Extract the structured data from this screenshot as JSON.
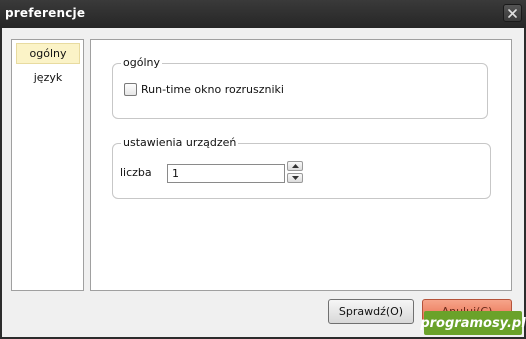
{
  "window": {
    "title": "preferencje",
    "close_glyph": "×"
  },
  "sidebar": {
    "items": [
      {
        "label": "ogólny",
        "selected": true
      },
      {
        "label": "język",
        "selected": false
      }
    ]
  },
  "general_group": {
    "legend": "ogólny",
    "checkbox_label": "Run-time okno rozruszniki",
    "checkbox_checked": false
  },
  "device_group": {
    "legend": "ustawienia urządzeń",
    "count_label": "liczba",
    "count_value": "1"
  },
  "footer": {
    "check_button_label": "Sprawdź(O)",
    "apply_button_label": "Anuluj(C)"
  },
  "watermark": {
    "text": "programosy.pl",
    "color": "#6aa22a"
  },
  "colors": {
    "titlebar": "#2c2c2c",
    "selected_item": "#fbf3c7",
    "primary_button": "#e76b4b"
  }
}
